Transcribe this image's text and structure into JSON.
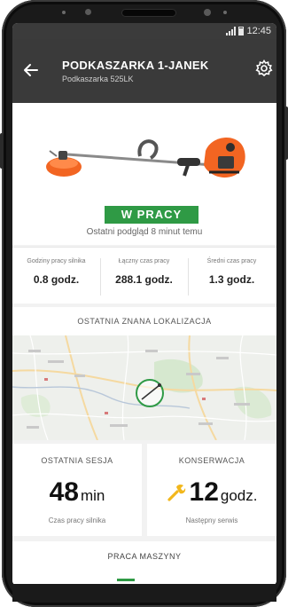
{
  "status_bar": {
    "time": "12:45"
  },
  "app_bar": {
    "title": "PODKASZARKA 1-JANEK",
    "subtitle": "Podkaszarka 525LK"
  },
  "product": {
    "status": "W PRACY",
    "last_seen": "Ostatni podgląd 8 minut temu"
  },
  "stats": [
    {
      "label": "Godziny pracy silnika",
      "value": "0.8 godz."
    },
    {
      "label": "Łączny czas pracy",
      "value": "288.1 godz."
    },
    {
      "label": "Średni czas pracy",
      "value": "1.3 godz."
    }
  ],
  "location": {
    "header": "OSTATNIA ZNANA LOKALIZACJA"
  },
  "session_card": {
    "title": "OSTATNIA SESJA",
    "value": "48",
    "unit": "min",
    "subtitle": "Czas pracy silnika"
  },
  "service_card": {
    "title": "KONSERWACJA",
    "value": "12",
    "unit": "godz.",
    "subtitle": "Następny serwis"
  },
  "tab": {
    "label": "PRACA MASZYNY"
  },
  "icons": {
    "back": "arrow-left-icon",
    "settings": "gear-icon",
    "map_pin": "map-marker-icon",
    "maintenance": "wrench-icon"
  },
  "colors": {
    "app_bar": "#3a3a3a",
    "status_green": "#2f9a45",
    "brand_orange": "#f26522",
    "wrench_yellow": "#f2b71c"
  }
}
